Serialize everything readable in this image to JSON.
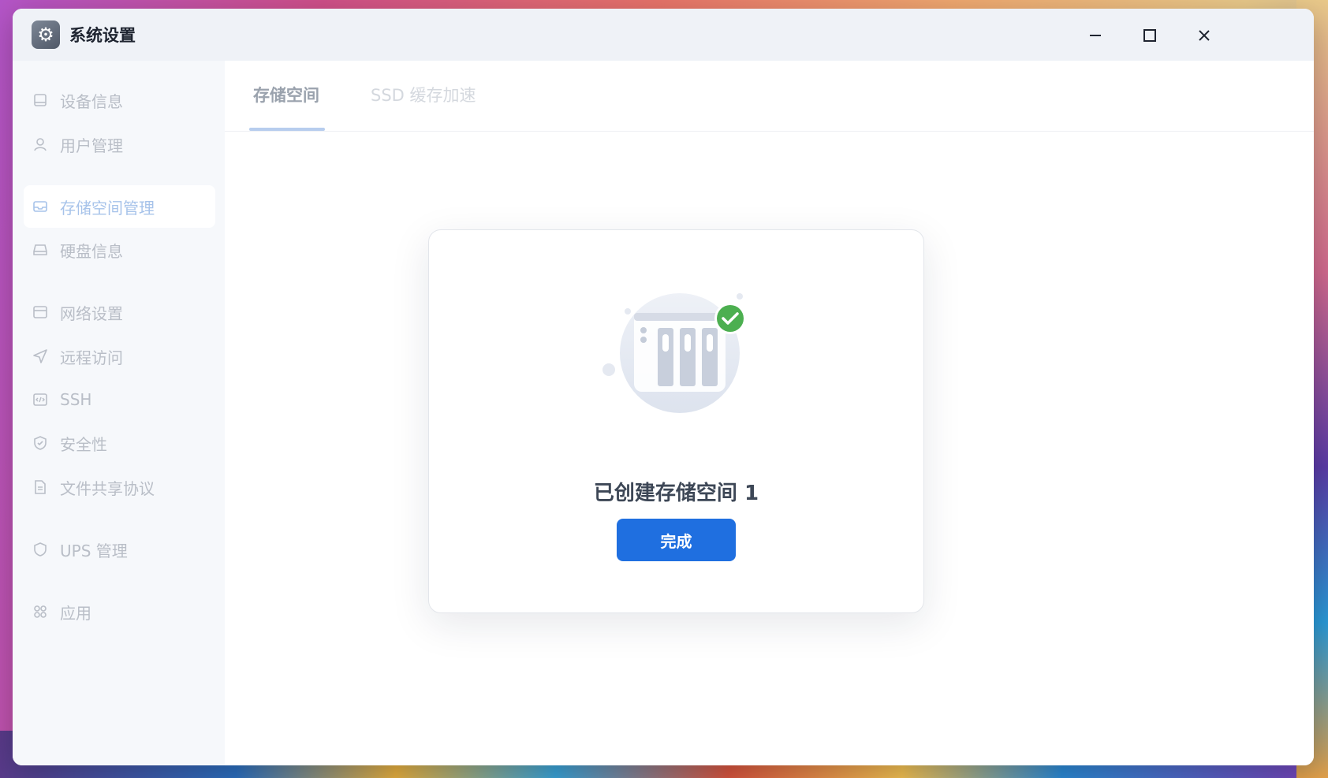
{
  "window": {
    "title": "系统设置",
    "app_icon": "gear-icon",
    "controls": [
      "minimize-icon",
      "maximize-icon",
      "close-icon"
    ]
  },
  "sidebar": {
    "items": [
      {
        "label": "设备信息",
        "icon": "device-icon"
      },
      {
        "label": "用户管理",
        "icon": "user-icon"
      },
      {
        "label": "存储空间管理",
        "icon": "storage-icon",
        "active": true
      },
      {
        "label": "硬盘信息",
        "icon": "disk-icon"
      },
      {
        "label": "网络设置",
        "icon": "network-icon"
      },
      {
        "label": "远程访问",
        "icon": "send-icon"
      },
      {
        "label": "SSH",
        "icon": "code-icon"
      },
      {
        "label": "安全性",
        "icon": "shield-check-icon"
      },
      {
        "label": "文件共享协议",
        "icon": "file-icon"
      },
      {
        "label": "UPS 管理",
        "icon": "shield-icon"
      },
      {
        "label": "应用",
        "icon": "apps-icon"
      }
    ]
  },
  "tabs": [
    {
      "label": "存储空间",
      "active": true
    },
    {
      "label": "SSD 缓存加速",
      "active": false
    }
  ],
  "dialog": {
    "illustration": "nas-success-icon",
    "message": "已创建存储空间 1",
    "button_label": "完成"
  },
  "colors": {
    "accent": "#1f6fe0",
    "success": "#4caf50",
    "sidebar_text": "#b9bec7"
  }
}
